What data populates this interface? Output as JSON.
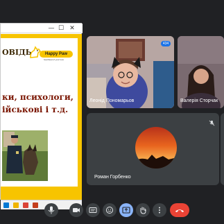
{
  "shared_window": {
    "controls": {
      "minimize": "—",
      "maximize": "☐",
      "close": "✕"
    },
    "slide": {
      "title_fragment": "ОВІДЬ",
      "logo_text": "Happy Paw",
      "logo_tagline": "heartbeat of your love",
      "line1": "ки, психологи,",
      "line2": "ійськові і т.д."
    }
  },
  "participants": [
    {
      "name": "Леонід Пономарьов",
      "badge": "434"
    },
    {
      "name": "Валерія Сторчак"
    },
    {
      "name": "Роман Горбенко"
    }
  ],
  "colors": {
    "background": "#202124",
    "tile": "#3c4043",
    "accent_yellow": "#f7c400",
    "present_active": "#8ab4f8",
    "end_call": "#ea4335"
  },
  "icons": {
    "more_participant": "more-vert-icon",
    "muted": "mic-off-icon",
    "controls": [
      "chevron-up-icon",
      "microphone-icon",
      "chevron-up-icon",
      "camera-icon",
      "captions-icon",
      "emoji-icon",
      "present-screen-icon",
      "raise-hand-icon",
      "more-options-icon",
      "end-call-icon"
    ]
  }
}
